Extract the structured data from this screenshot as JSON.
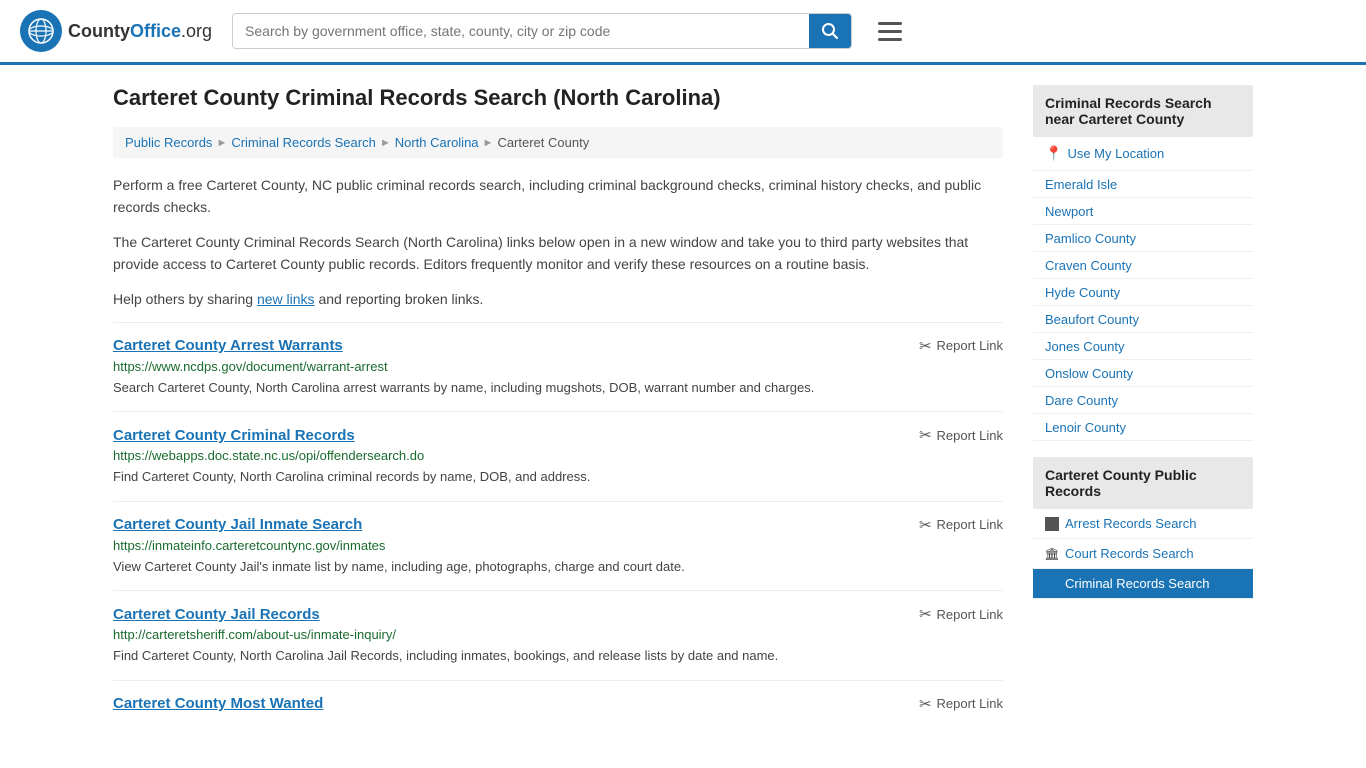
{
  "header": {
    "logo_text": "CountyOffice",
    "logo_suffix": ".org",
    "search_placeholder": "Search by government office, state, county, city or zip code",
    "search_value": ""
  },
  "page": {
    "title": "Carteret County Criminal Records Search (North Carolina)"
  },
  "breadcrumb": {
    "items": [
      {
        "label": "Public Records",
        "href": "#"
      },
      {
        "label": "Criminal Records Search",
        "href": "#"
      },
      {
        "label": "North Carolina",
        "href": "#"
      },
      {
        "label": "Carteret County",
        "href": "#"
      }
    ]
  },
  "description": {
    "para1": "Perform a free Carteret County, NC public criminal records search, including criminal background checks, criminal history checks, and public records checks.",
    "para2": "The Carteret County Criminal Records Search (North Carolina) links below open in a new window and take you to third party websites that provide access to Carteret County public records. Editors frequently monitor and verify these resources on a routine basis.",
    "para3_pre": "Help others by sharing ",
    "para3_link": "new links",
    "para3_post": " and reporting broken links."
  },
  "records": [
    {
      "title": "Carteret County Arrest Warrants",
      "url": "https://www.ncdps.gov/document/warrant-arrest",
      "desc": "Search Carteret County, North Carolina arrest warrants by name, including mugshots, DOB, warrant number and charges.",
      "report_label": "Report Link"
    },
    {
      "title": "Carteret County Criminal Records",
      "url": "https://webapps.doc.state.nc.us/opi/offendersearch.do",
      "desc": "Find Carteret County, North Carolina criminal records by name, DOB, and address.",
      "report_label": "Report Link"
    },
    {
      "title": "Carteret County Jail Inmate Search",
      "url": "https://inmateinfo.carteretcountync.gov/inmates",
      "desc": "View Carteret County Jail's inmate list by name, including age, photographs, charge and court date.",
      "report_label": "Report Link"
    },
    {
      "title": "Carteret County Jail Records",
      "url": "http://carteretsheriff.com/about-us/inmate-inquiry/",
      "desc": "Find Carteret County, North Carolina Jail Records, including inmates, bookings, and release lists by date and name.",
      "report_label": "Report Link"
    },
    {
      "title": "Carteret County Most Wanted",
      "url": "",
      "desc": "",
      "report_label": "Report Link"
    }
  ],
  "sidebar": {
    "nearby_title": "Criminal Records Search near Carteret County",
    "use_my_location": "Use My Location",
    "nearby_locations": [
      {
        "label": "Emerald Isle",
        "href": "#"
      },
      {
        "label": "Newport",
        "href": "#"
      },
      {
        "label": "Pamlico County",
        "href": "#"
      },
      {
        "label": "Craven County",
        "href": "#"
      },
      {
        "label": "Hyde County",
        "href": "#"
      },
      {
        "label": "Beaufort County",
        "href": "#"
      },
      {
        "label": "Jones County",
        "href": "#"
      },
      {
        "label": "Onslow County",
        "href": "#"
      },
      {
        "label": "Dare County",
        "href": "#"
      },
      {
        "label": "Lenoir County",
        "href": "#"
      }
    ],
    "public_records_title": "Carteret County Public Records",
    "public_records_links": [
      {
        "label": "Arrest Records Search",
        "href": "#",
        "active": false,
        "icon": "square"
      },
      {
        "label": "Court Records Search",
        "href": "#",
        "active": false,
        "icon": "building"
      },
      {
        "label": "Criminal Records Search",
        "href": "#",
        "active": true,
        "icon": "square"
      }
    ]
  }
}
